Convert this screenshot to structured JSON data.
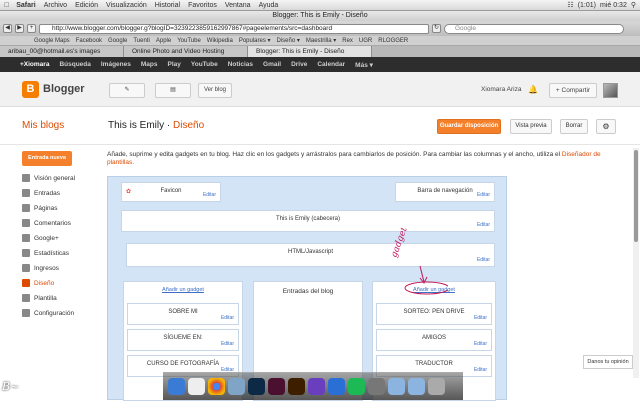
{
  "menubar": {
    "app": "Safari",
    "items": [
      "Archivo",
      "Edición",
      "Visualización",
      "Historial",
      "Favoritos",
      "Ventana",
      "Ayuda"
    ],
    "battery": "(1:01)",
    "clock": "mié 0:32"
  },
  "window": {
    "title": "Blogger: This is Emily - Diseño",
    "url": "http://www.blogger.com/blogger.g?blogID=3239223859162997867#pageelements/src=dashboard",
    "search_placeholder": "Google"
  },
  "bookmarks": [
    "Google Maps",
    "Facebook",
    "Google",
    "Tuenti",
    "Apple",
    "YouTube",
    "Wikipedia",
    "Populares ▾",
    "Diseño ▾",
    "Maestrilla ▾",
    "Rex",
    "UGR",
    "RLOGGER"
  ],
  "tabs": [
    "aribau_00@hotmail.es's images",
    "Online Photo and Video Hosting",
    "Blogger: This is Emily - Diseño"
  ],
  "active_tab": 2,
  "gbar": [
    "+Xiomara",
    "Búsqueda",
    "Imágenes",
    "Maps",
    "Play",
    "YouTube",
    "Noticias",
    "Gmail",
    "Drive",
    "Calendar",
    "Más ▾"
  ],
  "header": {
    "logo_letter": "B",
    "logo_text": "Blogger",
    "view_blog": "Ver blog",
    "user": "Xiomara Ariza",
    "share": "+ Compartir"
  },
  "subheader": {
    "my_blogs": "Mis blogs",
    "blog_title": "This is Emily",
    "separator": "·",
    "section": "Diseño",
    "save": "Guardar disposición",
    "preview": "Vista previa",
    "delete": "Borrar"
  },
  "sidebar": {
    "new_entry": "Entrada nueva",
    "items": [
      "Visión general",
      "Entradas",
      "Páginas",
      "Comentarios",
      "Google+",
      "Estadísticas",
      "Ingresos",
      "Diseño",
      "Plantilla",
      "Configuración"
    ],
    "active": 7
  },
  "description": {
    "text": "Añade, suprime y edita gadgets en tu blog. Haz clic en los gadgets y arrástralos para cambiarlos de posición. Para cambiar las columnas y el ancho, utiliza el",
    "link": "Diseñador de plantillas."
  },
  "layout": {
    "favicon": "Favicon",
    "navbar": "Barra de navegación",
    "header": "This is Emily (cabecera)",
    "html": "HTML/Javascript",
    "add_gadget": "Añadir un gadget",
    "blog_posts": "Entradas del blog",
    "edit": "Editar",
    "left_gadgets": [
      "SOBRE MI",
      "SÍGUEME EN:",
      "CURSO DE FOTOGRAFÍA"
    ],
    "right_gadgets": [
      "SORTEO: PEN DRIVE",
      "AMIGOS",
      "TRADUCTOR"
    ],
    "annotation": "gadget HTML"
  },
  "feedback": "Danos tu opinión",
  "signature": "B~"
}
